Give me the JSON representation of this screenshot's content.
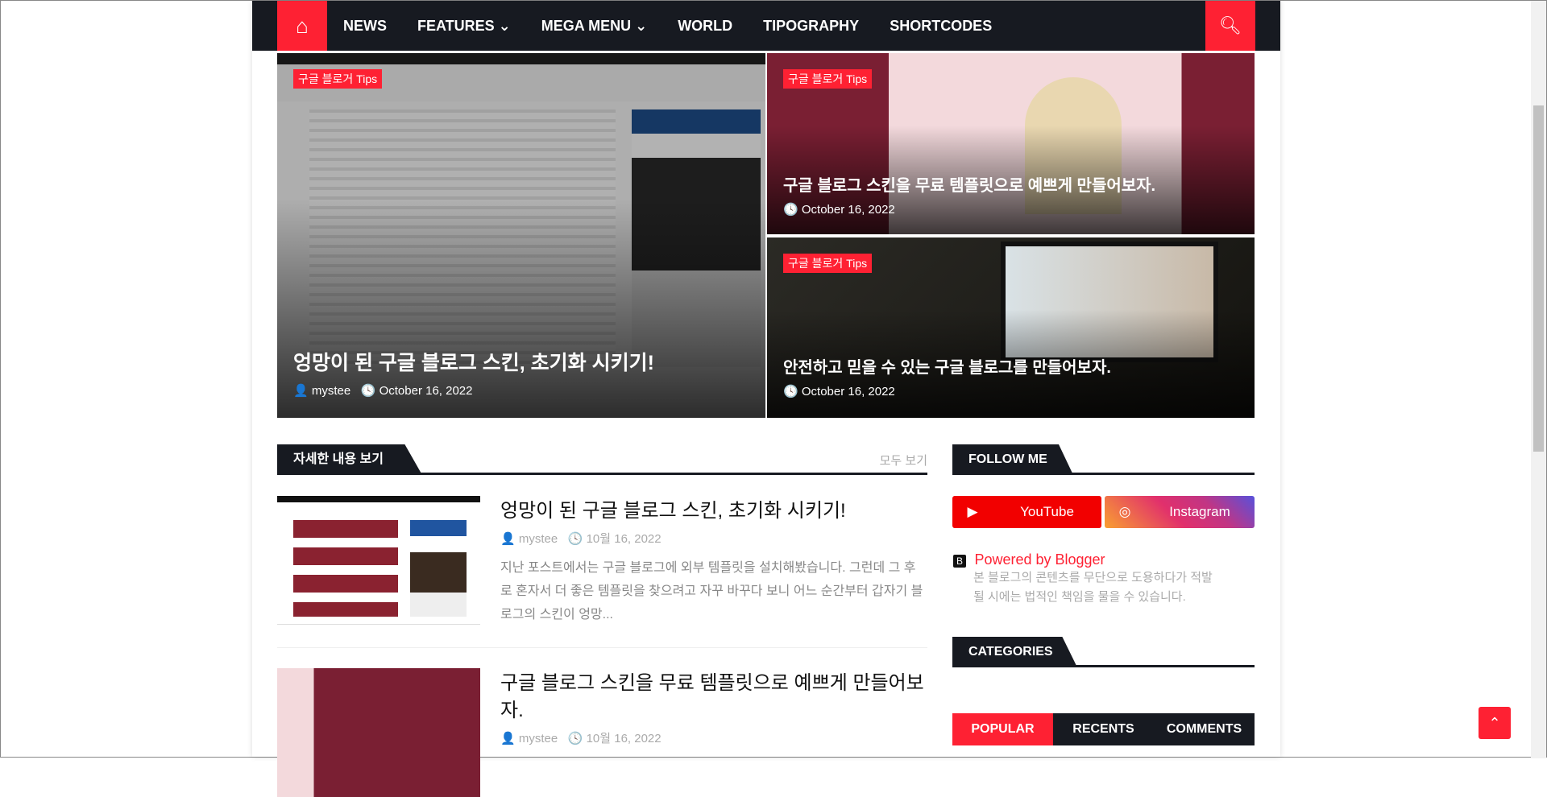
{
  "nav": {
    "items": [
      "NEWS",
      "FEATURES ⌄",
      "MEGA MENU ⌄",
      "WORLD",
      "TIPOGRAPHY",
      "SHORTCODES"
    ],
    "home_icon": "home-icon",
    "search_icon": "search-icon"
  },
  "hero": [
    {
      "label": "구글 블로거 Tips",
      "title": "엉망이 된 구글 블로그 스킨, 초기화 시키기!",
      "author": "mystee",
      "date": "October 16, 2022"
    },
    {
      "label": "구글 블로거 Tips",
      "title": "구글 블로그 스킨을 무료 템플릿으로 예쁘게 만들어보자.",
      "date": "October 16, 2022"
    },
    {
      "label": "구글 블로거 Tips",
      "title": "안전하고 믿을 수 있는 구글 블로그를 만들어보자.",
      "date": "October 16, 2022"
    }
  ],
  "section": {
    "title": "자세한 내용 보기",
    "view_all": "모두 보기"
  },
  "posts": [
    {
      "title": "엉망이 된 구글 블로그 스킨, 초기화 시키기!",
      "author": "mystee",
      "date": "10월 16, 2022",
      "excerpt": "지난 포스트에서는 구글 블로그에 외부 템플릿을 설치해봤습니다. 그런데 그 후로 혼자서 더 좋은 템플릿을 찾으려고 자꾸 바꾸다 보니 어느 순간부터 갑자기 블로그의 스킨이 엉망..."
    },
    {
      "title": "구글 블로그 스킨을 무료 템플릿으로 예쁘게 만들어보자.",
      "author": "mystee",
      "date": "10월 16, 2022"
    }
  ],
  "sidebar": {
    "follow_title": "FOLLOW ME",
    "youtube": "YouTube",
    "instagram": "Instagram",
    "powered": "Powered by Blogger",
    "notice": "본 블로그의 콘텐츠를 무단으로 도용하다가 적발될 시에는 법적인 책임을 물을 수 있습니다.",
    "categories_title": "CATEGORIES",
    "tabs": [
      "POPULAR",
      "RECENTS",
      "COMMENTS"
    ]
  },
  "colors": {
    "accent": "#fe2133",
    "dark": "#171a21"
  }
}
